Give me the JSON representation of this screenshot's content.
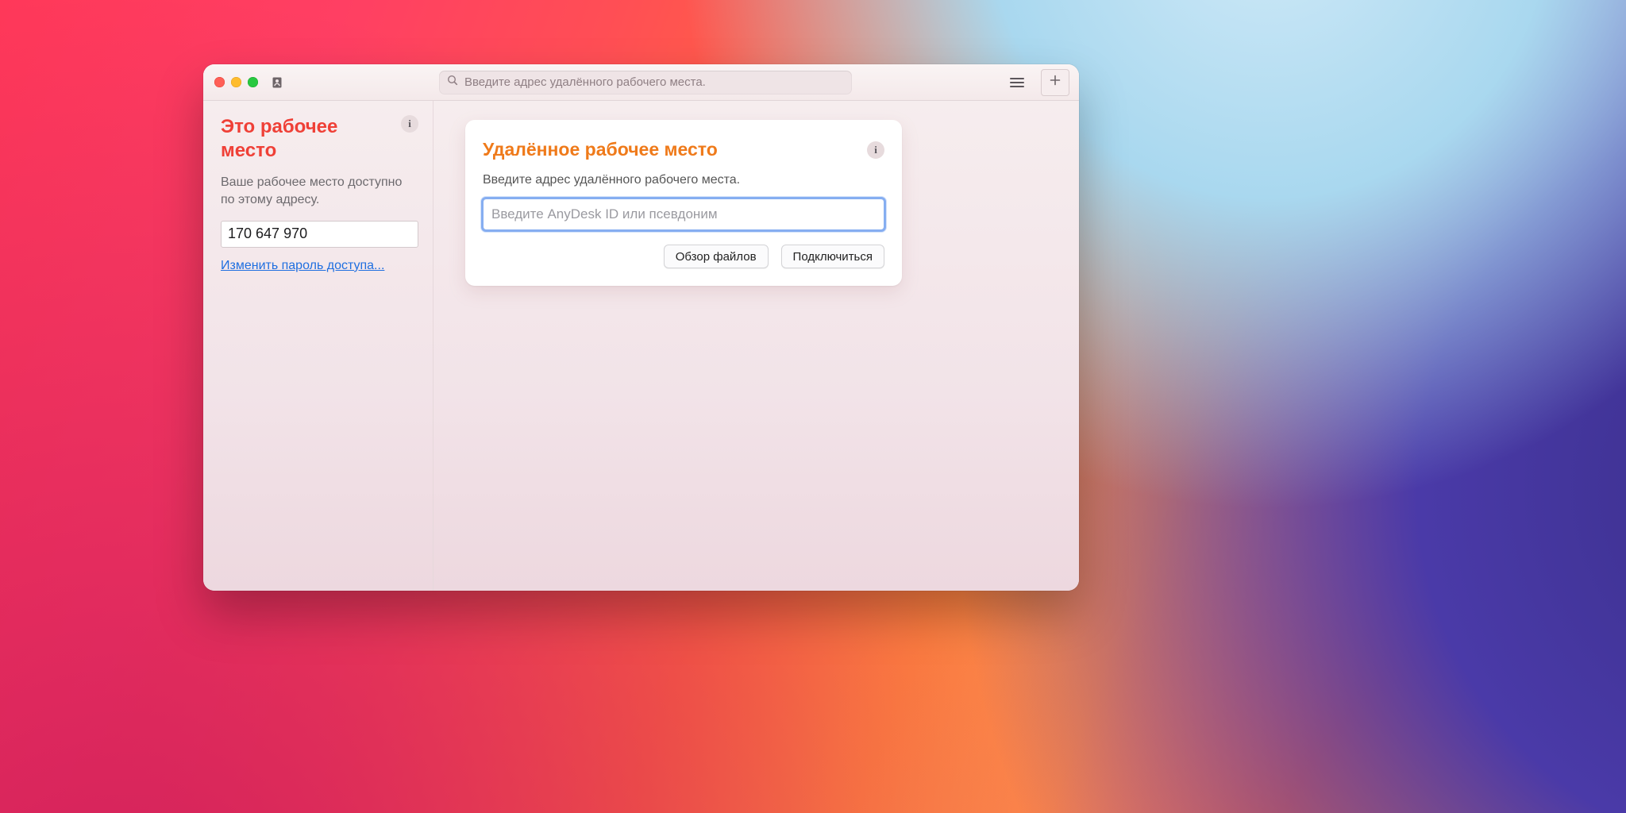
{
  "titlebar": {
    "search_placeholder": "Введите адрес удалённого рабочего места."
  },
  "sidebar": {
    "title": "Это рабочее место",
    "description": "Ваше рабочее место доступно по этому адресу.",
    "id_value": "170 647 970",
    "change_password_link": "Изменить пароль доступа..."
  },
  "main": {
    "card_title": "Удалённое рабочее место",
    "card_description": "Введите адрес удалённого рабочего места.",
    "remote_input_placeholder": "Введите AnyDesk ID или псевдоним",
    "browse_files_label": "Обзор файлов",
    "connect_label": "Подключиться"
  },
  "info_glyph": "i"
}
